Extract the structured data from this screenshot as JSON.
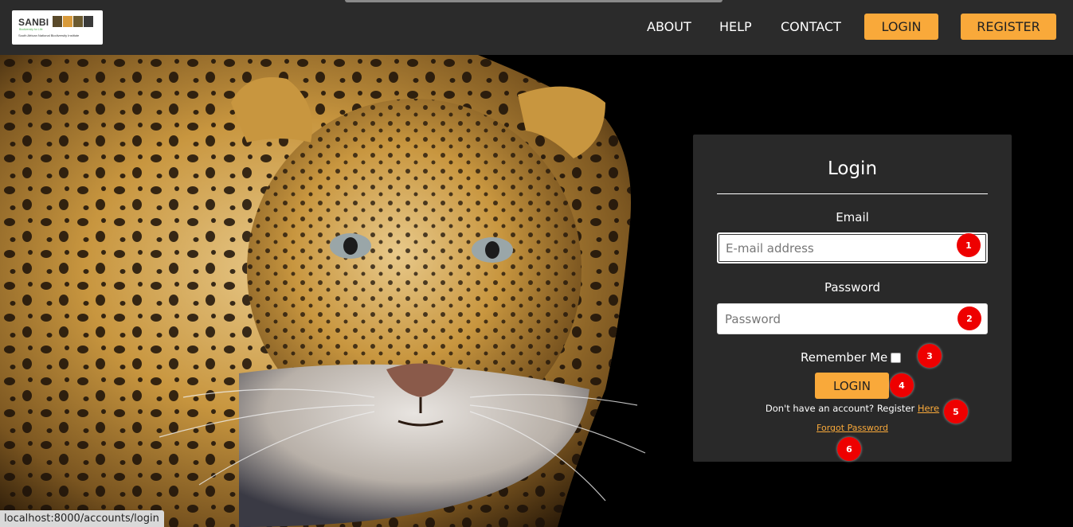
{
  "logo": {
    "word": "SANBI",
    "tagline": "Biodiversity for Life",
    "subtitle": "South African National Biodiversity Institute"
  },
  "nav": {
    "about": "ABOUT",
    "help": "HELP",
    "contact": "CONTACT",
    "login": "LOGIN",
    "register": "REGISTER"
  },
  "login_form": {
    "title": "Login",
    "email_label": "Email",
    "email_placeholder": "E-mail address",
    "password_label": "Password",
    "password_placeholder": "Password",
    "remember_label": "Remember Me",
    "submit_label": "LOGIN",
    "register_prompt": "Don't have an account? Register",
    "register_link": "Here",
    "forgot_link": "Forgot Password"
  },
  "markers": [
    "1",
    "2",
    "3",
    "4",
    "5",
    "6"
  ],
  "status_url": "localhost:8000/accounts/login",
  "colors": {
    "accent": "#f9a93a",
    "navbar": "#2b2b2b",
    "panel": "#292929",
    "marker": "#e00000"
  },
  "hero_image": "leopard-photo"
}
